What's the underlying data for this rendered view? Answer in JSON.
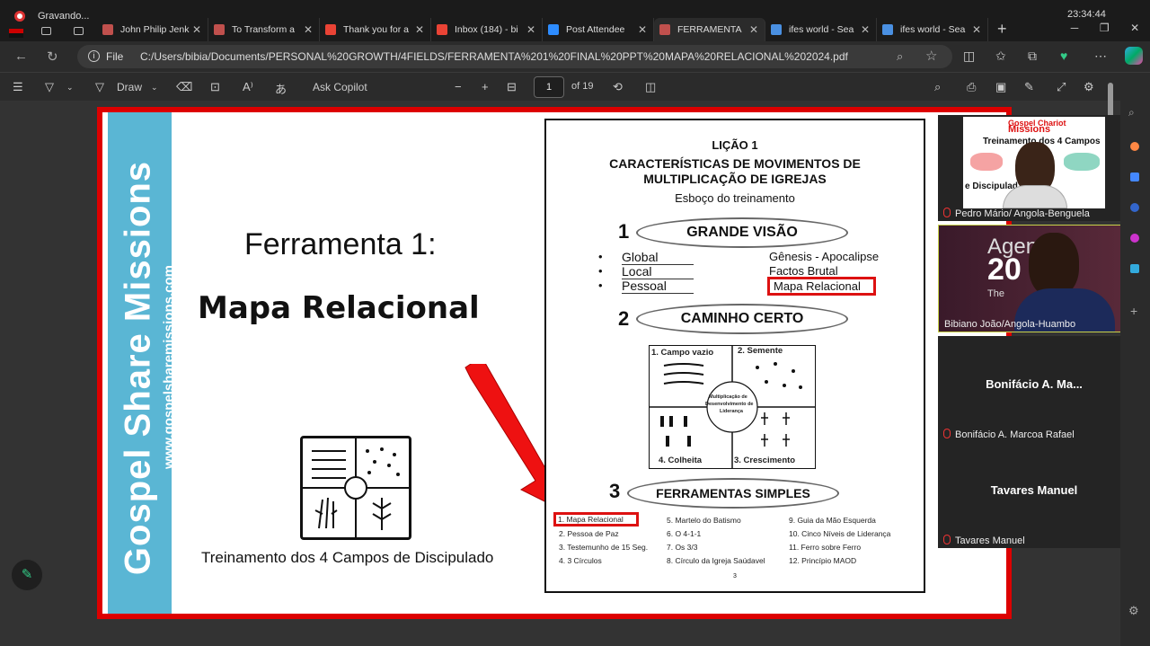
{
  "recording": {
    "label": "Gravando..."
  },
  "clock": "23:34:44",
  "tabs": [
    {
      "title": "John Philip Jenk",
      "icon": "pdf-icon",
      "color": "#c0504d"
    },
    {
      "title": "To Transform a",
      "icon": "pdf-icon",
      "color": "#c0504d"
    },
    {
      "title": "Thank you for a",
      "icon": "gmail-icon",
      "color": "#ea4335"
    },
    {
      "title": "Inbox (184) - bi",
      "icon": "gmail-icon",
      "color": "#ea4335"
    },
    {
      "title": "Post Attendee",
      "icon": "zoom-icon",
      "color": "#2d8cff"
    },
    {
      "title": "FERRAMENTA",
      "icon": "pdf-icon",
      "color": "#c0504d",
      "active": true
    },
    {
      "title": "ifes world - Sea",
      "icon": "search-icon",
      "color": "#4a90e2"
    },
    {
      "title": "ifes world - Sea",
      "icon": "search-icon",
      "color": "#4a90e2"
    }
  ],
  "address": {
    "scheme": "File",
    "url": "C:/Users/bibia/Documents/PERSONAL%20GROWTH/4FIELDS/FERRAMENTA%201%20FINAL%20PPT%20MAPA%20RELACIONAL%202024.pdf"
  },
  "pdf_toolbar": {
    "draw_label": "Draw",
    "copilot_label": "Ask Copilot",
    "page": "1",
    "of_pages": "of 19"
  },
  "slide": {
    "band_text": "Gospel Share Missions",
    "band_url": "www.gospelsharemissions.com",
    "tool_title": "Ferramenta 1:",
    "main_title": "Mapa Relacional",
    "caption": "Treinamento dos 4 Campos de Discipulado",
    "doc": {
      "lesson": "LIÇÃO 1",
      "heading1": "CARACTERÍSTICAS DE MOVIMENTOS DE",
      "heading2": "MULTIPLICAÇÃO DE IGREJAS",
      "subtitle": "Esboço do treinamento",
      "sec1_num": "1",
      "sec1_title": "GRANDE VISÃO",
      "bullets": [
        "Global",
        "Local",
        "Pessoal"
      ],
      "right_items": [
        "Gênesis - Apocalipse",
        "Factos Brutal",
        "Mapa Relacional"
      ],
      "sec2_num": "2",
      "sec2_title": "CAMINHO CERTO",
      "quadrants": [
        "1. Campo vazio",
        "2. Semente",
        "4. Colheita",
        "3. Crescimento"
      ],
      "center": [
        "Multiplicação de",
        "Desenvolvimento de",
        "Liderança"
      ],
      "sec3_num": "3",
      "sec3_title": "FERRAMENTAS SIMPLES",
      "tools_col1": [
        "1. Mapa Relacional",
        "2. Pessoa de Paz",
        "3. Testemunho de 15 Seg.",
        "4. 3 Círculos"
      ],
      "tools_col2": [
        "5. Martelo do Batismo",
        "6. O 4-1-1",
        "7. Os 3/3",
        "8. Círculo da Igreja Saúdavel"
      ],
      "tools_col3": [
        "9. Guia da Mão Esquerda",
        "10. Cinco Níveis de Liderança",
        "11. Ferro sobre Ferro",
        "12. Princípio MAOD"
      ],
      "page_num": "3"
    }
  },
  "participants": [
    {
      "name": "Pedro Mário/ Angola-Benguela",
      "muted": true,
      "video": true,
      "banner": [
        "Gospel Chariot",
        "Missions",
        "Treinamento dos 4 Campos",
        "e Discipulad"
      ]
    },
    {
      "name": "Bibiano João/Angola-Huambo",
      "muted": false,
      "video": true,
      "banner": [
        "Agen",
        "20",
        "The"
      ]
    },
    {
      "name": "Bonifácio A. Marcoa Rafael",
      "short": "Bonifácio A. Ma...",
      "muted": true,
      "video": false
    },
    {
      "name": "Tavares Manuel",
      "short": "Tavares Manuel",
      "muted": true,
      "video": false
    }
  ],
  "colors": {
    "accent_red": "#dd1111",
    "band_blue": "#5ab6d4"
  }
}
